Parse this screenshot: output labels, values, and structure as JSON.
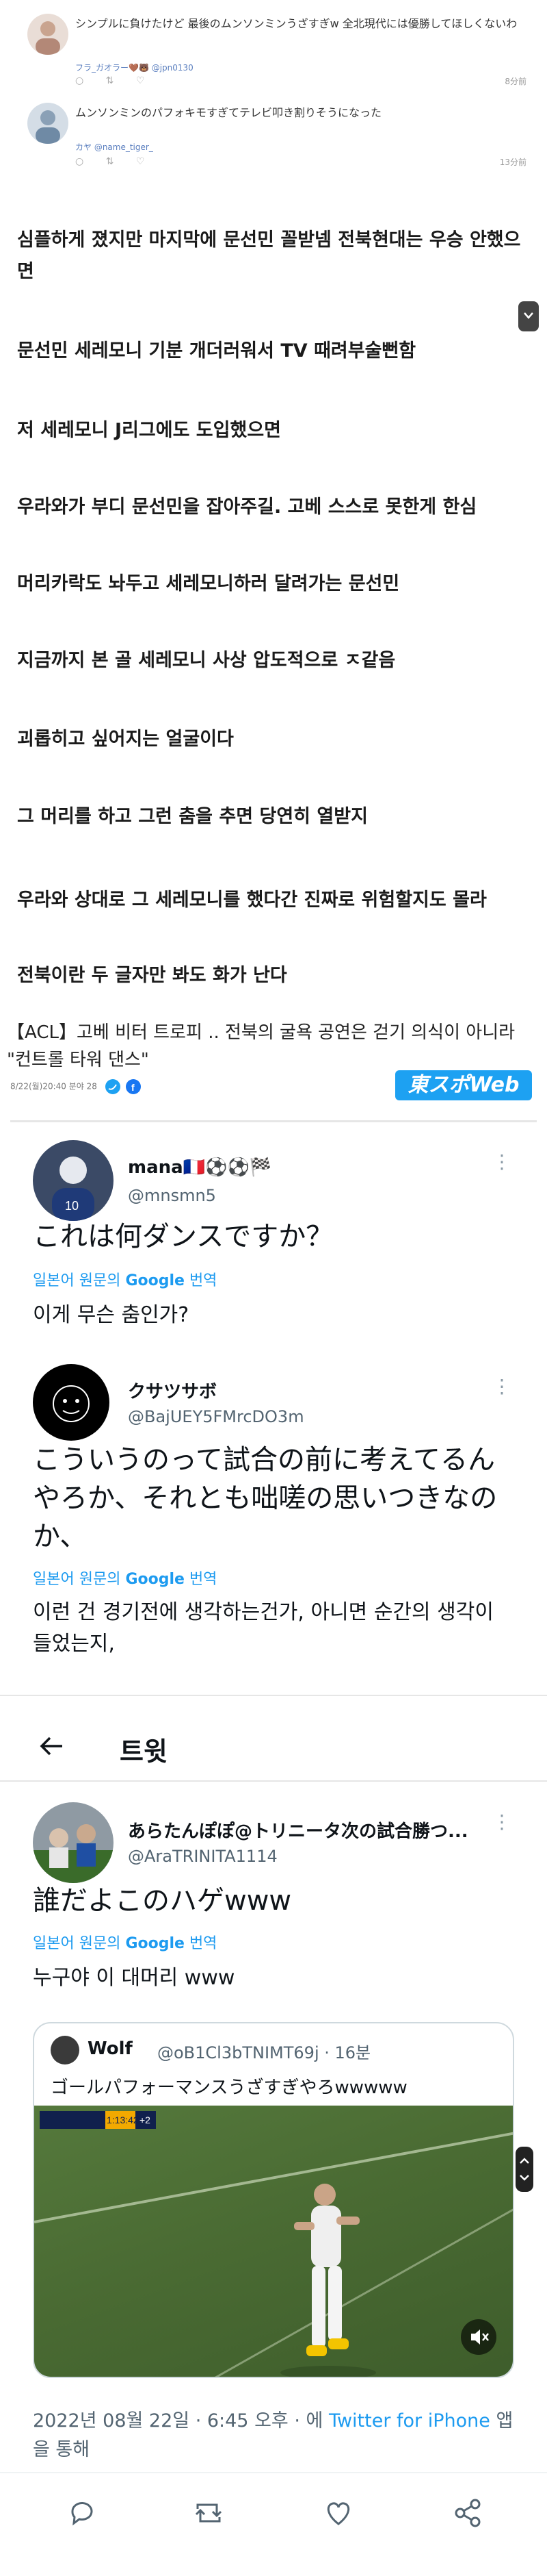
{
  "mini_tweets": [
    {
      "text": "シンプルに負けたけど 最後のムンソンミンうざすぎw 全北現代には優勝してほしくないわ",
      "meta": "フラ_ガオラー🤎🐻 @jpn0130",
      "time": "8分前"
    },
    {
      "text": "ムンソンミンのパフォキモすぎてテレビ叩き割りそうになった",
      "meta": "カヤ @name_tiger_",
      "time": "13分前"
    }
  ],
  "comments": [
    "심플하게 졌지만 마지막에 문선민 꼴받넴 전북현대는 우승 안했으면",
    "문선민 세레모니 기분 개더러워서 TV 때려부술뻔함",
    "저 세레모니 J리그에도 도입했으면",
    "우라와가 부디 문선민을 잡아주길. 고베 스스로 못한게 한심",
    "머리카락도 놔두고 세레모니하러 달려가는 문선민",
    "지금까지 본 골 세레모니 사상 압도적으로 ㅈ같음",
    "괴롭히고 싶어지는 얼굴이다",
    "그 머리를 하고 그런 춤을 추면 당연히 열받지",
    "우라와 상대로 그 세레모니를 했다간 진짜로 위험할지도 몰라",
    "전북이란 두 글자만 봐도 화가 난다"
  ],
  "news": {
    "headline": "【ACL】고베 비터 트로피 .. 전북의 굴욕 공연은 걷기 의식이 아니라 \"컨트롤 타워 댄스\"",
    "meta": "8/22(월)20:40 분야 28",
    "logo": "東スポWeb"
  },
  "replies": [
    {
      "name": "mana🇫🇷⚽⚽🏁",
      "handle": "@mnsmn5",
      "body": "これは何ダンスですか？",
      "translate_label": "일본어 원문의",
      "translate_google": "Google",
      "translate_suffix": "번역",
      "translation": "이게 무슨 춤인가?"
    },
    {
      "name": "クサツサボ",
      "handle": "@BajUEY5FMrcDO3m",
      "body": "こういうのって試合の前に考えてるんやろか、それとも咄嗟の思いつきなのか、",
      "translate_label": "일본어 원문의",
      "translate_google": "Google",
      "translate_suffix": "번역",
      "translation": "이런 건 경기전에 생각하는건가, 아니면 순간의 생각이 들었는지,"
    }
  ],
  "thread": {
    "header_title": "트윗",
    "name": "あらたんぽぽ@トリニータ次の試合勝つ...",
    "handle": "@AraTRINITA1114",
    "body": "誰だよこのハゲwww",
    "translate_label": "일본어 원문의",
    "translate_google": "Google",
    "translate_suffix": "번역",
    "translation": "누구야 이 대머리 www",
    "quote": {
      "name": "Wolf",
      "handle": "@oB1Cl3bTNIMT69j · 16분",
      "text": "ゴールパフォーマンスうざすぎやろwwwww",
      "score": "1:13:42",
      "badge": "+2"
    },
    "timestamp_prefix": "2022년 08월 22일 · 6:45 오후 · 에",
    "source": "Twitter for iPhone",
    "timestamp_suffix": "앱을 통해"
  },
  "colors": {
    "twitter_blue": "#1d9bf0",
    "muted_text": "#536471"
  }
}
